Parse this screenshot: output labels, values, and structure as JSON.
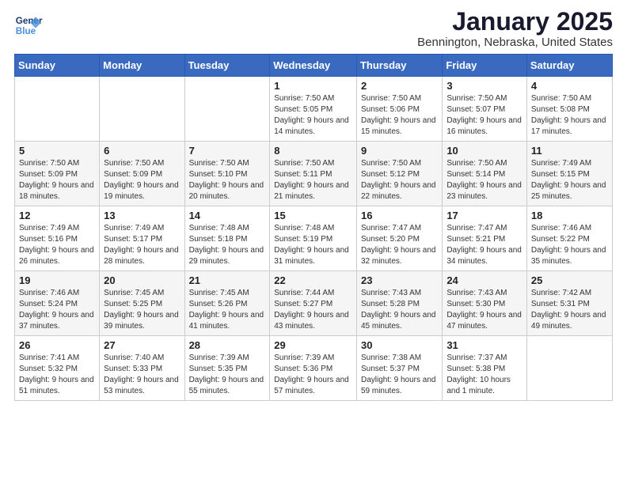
{
  "logo": {
    "text_general": "General",
    "text_blue": "Blue"
  },
  "header": {
    "title": "January 2025",
    "subtitle": "Bennington, Nebraska, United States"
  },
  "weekdays": [
    "Sunday",
    "Monday",
    "Tuesday",
    "Wednesday",
    "Thursday",
    "Friday",
    "Saturday"
  ],
  "weeks": [
    [
      {
        "day": "",
        "sunrise": "",
        "sunset": "",
        "daylight": ""
      },
      {
        "day": "",
        "sunrise": "",
        "sunset": "",
        "daylight": ""
      },
      {
        "day": "",
        "sunrise": "",
        "sunset": "",
        "daylight": ""
      },
      {
        "day": "1",
        "sunrise": "Sunrise: 7:50 AM",
        "sunset": "Sunset: 5:05 PM",
        "daylight": "Daylight: 9 hours and 14 minutes."
      },
      {
        "day": "2",
        "sunrise": "Sunrise: 7:50 AM",
        "sunset": "Sunset: 5:06 PM",
        "daylight": "Daylight: 9 hours and 15 minutes."
      },
      {
        "day": "3",
        "sunrise": "Sunrise: 7:50 AM",
        "sunset": "Sunset: 5:07 PM",
        "daylight": "Daylight: 9 hours and 16 minutes."
      },
      {
        "day": "4",
        "sunrise": "Sunrise: 7:50 AM",
        "sunset": "Sunset: 5:08 PM",
        "daylight": "Daylight: 9 hours and 17 minutes."
      }
    ],
    [
      {
        "day": "5",
        "sunrise": "Sunrise: 7:50 AM",
        "sunset": "Sunset: 5:09 PM",
        "daylight": "Daylight: 9 hours and 18 minutes."
      },
      {
        "day": "6",
        "sunrise": "Sunrise: 7:50 AM",
        "sunset": "Sunset: 5:09 PM",
        "daylight": "Daylight: 9 hours and 19 minutes."
      },
      {
        "day": "7",
        "sunrise": "Sunrise: 7:50 AM",
        "sunset": "Sunset: 5:10 PM",
        "daylight": "Daylight: 9 hours and 20 minutes."
      },
      {
        "day": "8",
        "sunrise": "Sunrise: 7:50 AM",
        "sunset": "Sunset: 5:11 PM",
        "daylight": "Daylight: 9 hours and 21 minutes."
      },
      {
        "day": "9",
        "sunrise": "Sunrise: 7:50 AM",
        "sunset": "Sunset: 5:12 PM",
        "daylight": "Daylight: 9 hours and 22 minutes."
      },
      {
        "day": "10",
        "sunrise": "Sunrise: 7:50 AM",
        "sunset": "Sunset: 5:14 PM",
        "daylight": "Daylight: 9 hours and 23 minutes."
      },
      {
        "day": "11",
        "sunrise": "Sunrise: 7:49 AM",
        "sunset": "Sunset: 5:15 PM",
        "daylight": "Daylight: 9 hours and 25 minutes."
      }
    ],
    [
      {
        "day": "12",
        "sunrise": "Sunrise: 7:49 AM",
        "sunset": "Sunset: 5:16 PM",
        "daylight": "Daylight: 9 hours and 26 minutes."
      },
      {
        "day": "13",
        "sunrise": "Sunrise: 7:49 AM",
        "sunset": "Sunset: 5:17 PM",
        "daylight": "Daylight: 9 hours and 28 minutes."
      },
      {
        "day": "14",
        "sunrise": "Sunrise: 7:48 AM",
        "sunset": "Sunset: 5:18 PM",
        "daylight": "Daylight: 9 hours and 29 minutes."
      },
      {
        "day": "15",
        "sunrise": "Sunrise: 7:48 AM",
        "sunset": "Sunset: 5:19 PM",
        "daylight": "Daylight: 9 hours and 31 minutes."
      },
      {
        "day": "16",
        "sunrise": "Sunrise: 7:47 AM",
        "sunset": "Sunset: 5:20 PM",
        "daylight": "Daylight: 9 hours and 32 minutes."
      },
      {
        "day": "17",
        "sunrise": "Sunrise: 7:47 AM",
        "sunset": "Sunset: 5:21 PM",
        "daylight": "Daylight: 9 hours and 34 minutes."
      },
      {
        "day": "18",
        "sunrise": "Sunrise: 7:46 AM",
        "sunset": "Sunset: 5:22 PM",
        "daylight": "Daylight: 9 hours and 35 minutes."
      }
    ],
    [
      {
        "day": "19",
        "sunrise": "Sunrise: 7:46 AM",
        "sunset": "Sunset: 5:24 PM",
        "daylight": "Daylight: 9 hours and 37 minutes."
      },
      {
        "day": "20",
        "sunrise": "Sunrise: 7:45 AM",
        "sunset": "Sunset: 5:25 PM",
        "daylight": "Daylight: 9 hours and 39 minutes."
      },
      {
        "day": "21",
        "sunrise": "Sunrise: 7:45 AM",
        "sunset": "Sunset: 5:26 PM",
        "daylight": "Daylight: 9 hours and 41 minutes."
      },
      {
        "day": "22",
        "sunrise": "Sunrise: 7:44 AM",
        "sunset": "Sunset: 5:27 PM",
        "daylight": "Daylight: 9 hours and 43 minutes."
      },
      {
        "day": "23",
        "sunrise": "Sunrise: 7:43 AM",
        "sunset": "Sunset: 5:28 PM",
        "daylight": "Daylight: 9 hours and 45 minutes."
      },
      {
        "day": "24",
        "sunrise": "Sunrise: 7:43 AM",
        "sunset": "Sunset: 5:30 PM",
        "daylight": "Daylight: 9 hours and 47 minutes."
      },
      {
        "day": "25",
        "sunrise": "Sunrise: 7:42 AM",
        "sunset": "Sunset: 5:31 PM",
        "daylight": "Daylight: 9 hours and 49 minutes."
      }
    ],
    [
      {
        "day": "26",
        "sunrise": "Sunrise: 7:41 AM",
        "sunset": "Sunset: 5:32 PM",
        "daylight": "Daylight: 9 hours and 51 minutes."
      },
      {
        "day": "27",
        "sunrise": "Sunrise: 7:40 AM",
        "sunset": "Sunset: 5:33 PM",
        "daylight": "Daylight: 9 hours and 53 minutes."
      },
      {
        "day": "28",
        "sunrise": "Sunrise: 7:39 AM",
        "sunset": "Sunset: 5:35 PM",
        "daylight": "Daylight: 9 hours and 55 minutes."
      },
      {
        "day": "29",
        "sunrise": "Sunrise: 7:39 AM",
        "sunset": "Sunset: 5:36 PM",
        "daylight": "Daylight: 9 hours and 57 minutes."
      },
      {
        "day": "30",
        "sunrise": "Sunrise: 7:38 AM",
        "sunset": "Sunset: 5:37 PM",
        "daylight": "Daylight: 9 hours and 59 minutes."
      },
      {
        "day": "31",
        "sunrise": "Sunrise: 7:37 AM",
        "sunset": "Sunset: 5:38 PM",
        "daylight": "Daylight: 10 hours and 1 minute."
      },
      {
        "day": "",
        "sunrise": "",
        "sunset": "",
        "daylight": ""
      }
    ]
  ]
}
